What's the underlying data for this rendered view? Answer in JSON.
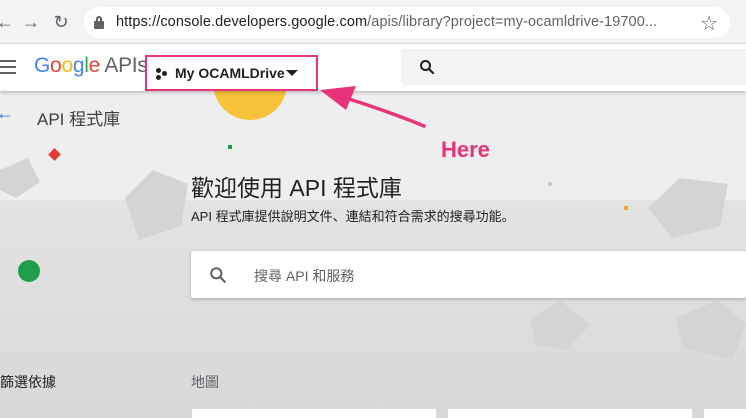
{
  "browser": {
    "url_host": "https://console.developers.google.com",
    "url_rest": "/apis/library?project=my-ocamldrive-19700..."
  },
  "header": {
    "logo_google": "Google",
    "logo_apis": "APIs",
    "project_name": "My OCAMLDrive"
  },
  "page": {
    "title": "API 程式庫",
    "hero_title": "歡迎使用 API 程式庫",
    "hero_subtitle": "API 程式庫提供說明文件、連結和符合需求的搜尋功能。",
    "search_placeholder": "搜尋 API 和服務",
    "filter_label": "篩選依據",
    "section_label": "地圖"
  },
  "annotation": {
    "text": "Here"
  },
  "colors": {
    "annotation": "#e8337a",
    "accent": "#1a73e8",
    "sun": "#f7c33a",
    "green_dot": "#1e9e48"
  },
  "icons": [
    "back-icon",
    "forward-icon",
    "reload-icon",
    "lock-icon",
    "star-icon",
    "menu-icon",
    "project-icon",
    "dropdown-icon",
    "search-icon",
    "arrow-back-icon"
  ]
}
